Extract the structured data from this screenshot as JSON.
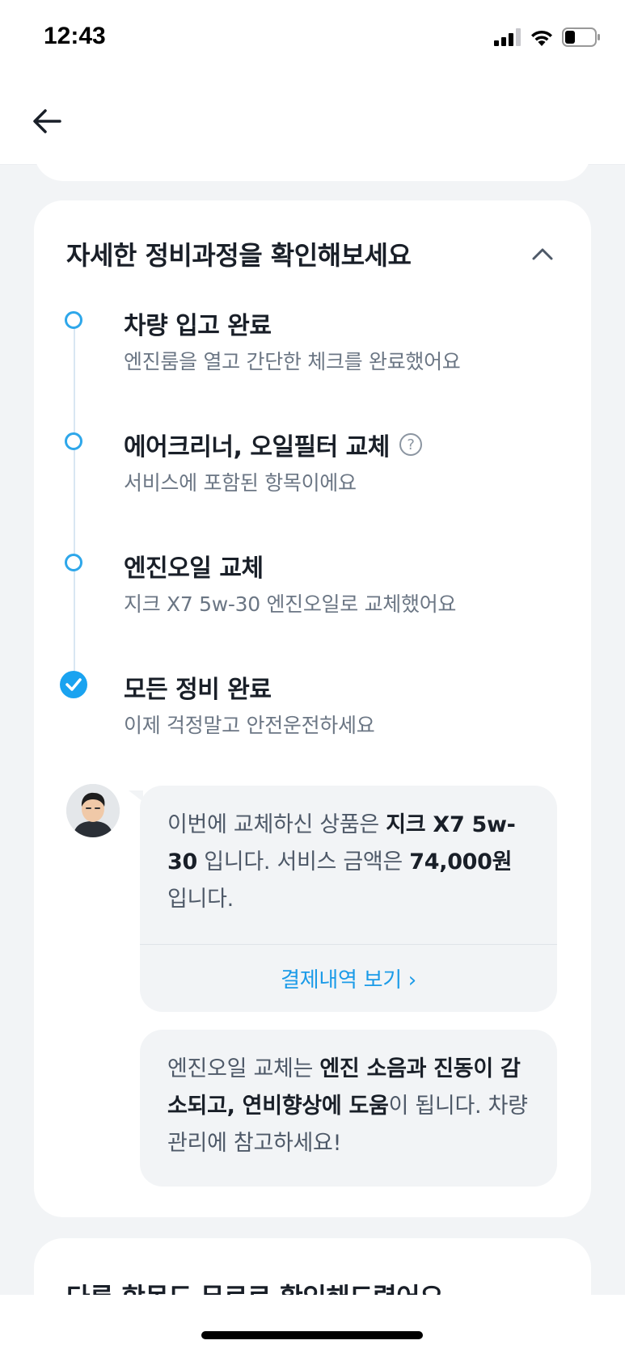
{
  "status": {
    "time": "12:43",
    "icons": [
      "signal-icon",
      "wifi-icon",
      "battery-icon"
    ]
  },
  "nav": {
    "back_icon": "arrow-left-icon"
  },
  "card": {
    "title": "자세한 정비과정을 확인해보세요",
    "toggle_icon": "chevron-up-icon",
    "steps": [
      {
        "title": "차량 입고 완료",
        "desc": "엔진룸을 열고 간단한 체크를 완료했어요",
        "status": "done-dot"
      },
      {
        "title": "에어크리너, 오일필터 교체",
        "desc": "서비스에 포함된 항목이에요",
        "status": "done-dot",
        "help": "?"
      },
      {
        "title": "엔진오일 교체",
        "desc": "지크 X7 5w-30 엔진오일로 교체했어요",
        "status": "done-dot"
      },
      {
        "title": "모든 정비 완료",
        "desc": "이제 걱정말고 안전운전하세요",
        "status": "complete-check"
      }
    ],
    "message1": {
      "part1": "이번에 교체하신 상품은 ",
      "bold1": "지크 X7 5w-30",
      "part2": " 입니다. 서비스 금액은 ",
      "bold2": "74,000원",
      "part3": " 입니다.",
      "link": "결제내역 보기 ›"
    },
    "message2": {
      "part1": "엔진오일 교체는 ",
      "bold1": "엔진 소음과 진동이 감소되고, 연비향상에 도움",
      "part2": "이 됩니다. 차량관리에 참고하세요!"
    }
  },
  "next_card": {
    "title": "다른 항목도 무료로 확인해드렸어요"
  },
  "colors": {
    "accent": "#1aa3f0",
    "link": "#1b9be8",
    "background": "#f2f4f6"
  }
}
